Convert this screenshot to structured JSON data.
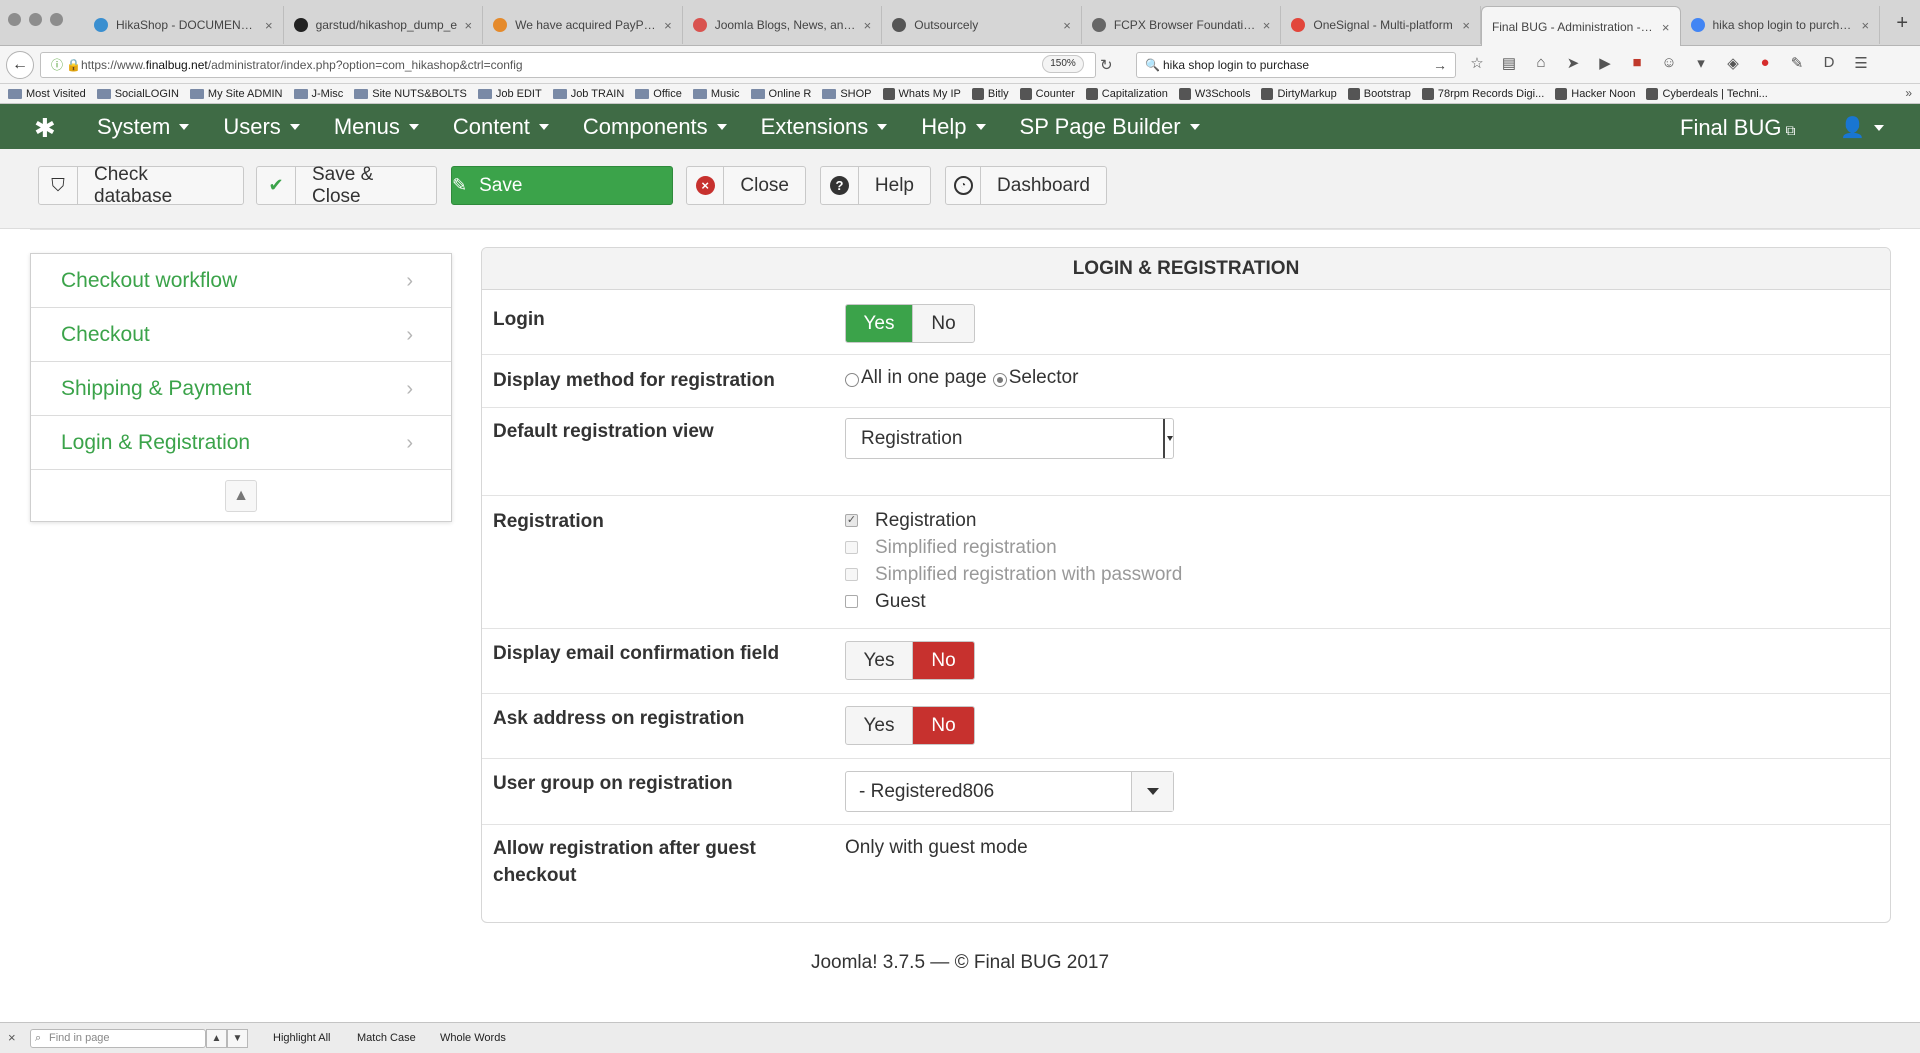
{
  "browser": {
    "tabs": [
      {
        "label": "HikaShop - DOCUMENTATI",
        "fav_color": "#3a8fd0",
        "active": false
      },
      {
        "label": "garstud/hikashop_dump_e",
        "fav_color": "#222222",
        "active": false
      },
      {
        "label": "We have acquired PayPlan",
        "fav_color": "#e58a2b",
        "active": false
      },
      {
        "label": "Joomla Blogs, News, and E",
        "fav_color": "#d9534f",
        "active": false
      },
      {
        "label": "Outsourcely",
        "fav_color": "#555555",
        "active": false
      },
      {
        "label": "FCPX Browser Foundation:",
        "fav_color": "#666666",
        "active": false
      },
      {
        "label": "OneSignal - Multi-platform",
        "fav_color": "#e2463b",
        "active": false
      },
      {
        "label": "Final BUG - Administration - Co",
        "fav_color": "",
        "active": true
      },
      {
        "label": "hika shop login to purchase",
        "fav_color": "#4285f4",
        "active": false
      }
    ],
    "url_prefix": "https://www.",
    "url_domain": "finalbug.net",
    "url_path": "/administrator/index.php?option=com_hikashop&ctrl=config",
    "zoom": "150%",
    "search_query": "hika shop login to purchase",
    "bookmarks": [
      "Most Visited",
      "SocialLOGIN",
      "My Site ADMIN",
      "J-Misc",
      "Site NUTS&BOLTS",
      "Job EDIT",
      "Job TRAIN",
      "Office",
      "Music",
      "Online R",
      "SHOP",
      "Whats My IP",
      "Bitly",
      "Counter",
      "Capitalization",
      "W3Schools",
      "DirtyMarkup",
      "Bootstrap",
      "78rpm Records Digi...",
      "Hacker Noon",
      "Cyberdeals | Techni..."
    ]
  },
  "admin": {
    "menu": [
      "System",
      "Users",
      "Menus",
      "Content",
      "Components",
      "Extensions",
      "Help",
      "SP Page Builder"
    ],
    "site_name": "Final BUG",
    "brand_green": "#3f6b45"
  },
  "toolbar": {
    "check_db": "Check database",
    "save_close": "Save & Close",
    "save": "Save",
    "close": "Close",
    "help": "Help",
    "dashboard": "Dashboard"
  },
  "sidebar": {
    "items": [
      {
        "label": "Checkout workflow"
      },
      {
        "label": "Checkout"
      },
      {
        "label": "Shipping & Payment"
      },
      {
        "label": "Login & Registration"
      }
    ]
  },
  "panel": {
    "title": "LOGIN & REGISTRATION",
    "yes": "Yes",
    "no": "No",
    "login": {
      "label": "Login",
      "value": "Yes"
    },
    "display_method": {
      "label": "Display method for registration",
      "options": [
        "All in one page",
        "Selector"
      ],
      "selected": "Selector"
    },
    "default_view": {
      "label": "Default registration view",
      "value": "Registration"
    },
    "registration": {
      "label": "Registration",
      "options": [
        {
          "label": "Registration",
          "checked": true,
          "disabled": true
        },
        {
          "label": "Simplified registration",
          "checked": false,
          "disabled": true
        },
        {
          "label": "Simplified registration with password",
          "checked": false,
          "disabled": true
        },
        {
          "label": "Guest",
          "checked": false,
          "disabled": false
        }
      ]
    },
    "email_confirm": {
      "label": "Display email confirmation field",
      "value": "No"
    },
    "ask_address": {
      "label": "Ask address on registration",
      "value": "No"
    },
    "user_group": {
      "label": "User group on registration",
      "value": "- Registered806"
    },
    "allow_after_guest": {
      "label": "Allow registration after guest checkout",
      "value": "Only with guest mode"
    }
  },
  "footer": {
    "text": "Joomla! 3.7.5  —  © Final BUG 2017"
  },
  "findbar": {
    "placeholder": "Find in page",
    "highlight_all": "Highlight All",
    "match_case": "Match Case",
    "whole_words": "Whole Words"
  }
}
